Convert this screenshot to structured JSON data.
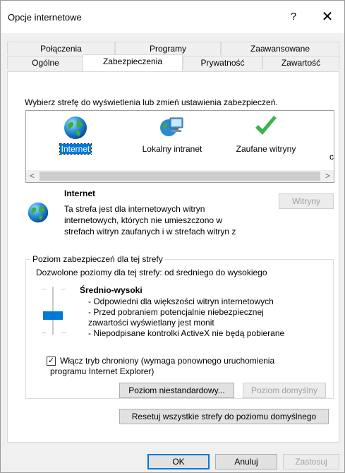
{
  "window": {
    "title": "Opcje internetowe",
    "help_label": "?",
    "close_label": "✕"
  },
  "tabs": {
    "row1": [
      "Połączenia",
      "Programy",
      "Zaawansowane"
    ],
    "row2": [
      "Ogólne",
      "Zabezpieczenia",
      "Prywatność",
      "Zawartość"
    ],
    "active": "Zabezpieczenia"
  },
  "zones": {
    "instruction": "Wybierz strefę do wyświetlenia lub zmień ustawienia zabezpieczeń.",
    "items": [
      {
        "label": "Internet",
        "icon": "globe-icon",
        "selected": true
      },
      {
        "label": "Lokalny intranet",
        "icon": "computer-network-icon",
        "selected": false
      },
      {
        "label": "Zaufane witryny",
        "icon": "checkmark-icon",
        "selected": false
      }
    ],
    "overflow_char": "c"
  },
  "zone_info": {
    "name": "Internet",
    "description": [
      "Ta strefa jest dla internetowych witryn",
      "internetowych, których nie umieszczono w",
      "strefach witryn zaufanych i w strefach witryn z"
    ],
    "sites_button": "Witryny"
  },
  "security_level": {
    "group_title": "Poziom zabezpieczeń dla tej strefy",
    "allowed": "Dozwolone poziomy dla tej strefy: od średniego do wysokiego",
    "level_name": "Średnio-wysoki",
    "details": [
      "- Odpowiedni dla większości witryn internetowych",
      "- Przed pobraniem potencjalnie niebezpiecznej",
      "zawartości wyświetlany jest monit",
      "- Niepodpisane kontrolki ActiveX nie będą pobierane"
    ],
    "protected_mode": {
      "checked": true,
      "label_line1": "Włącz tryb chroniony (wymaga ponownego uruchomienia",
      "label_line2": "programu Internet Explorer)"
    },
    "custom_button": "Poziom niestandardowy...",
    "default_button": "Poziom domyślny"
  },
  "reset_all_button": "Resetuj wszystkie strefy do poziomu domyślnego",
  "footer": {
    "ok": "OK",
    "cancel": "Anuluj",
    "apply": "Zastosuj"
  },
  "colors": {
    "accent": "#0078d7",
    "dialog_bg": "#f0f0f0",
    "panel_bg": "#ffffff"
  }
}
